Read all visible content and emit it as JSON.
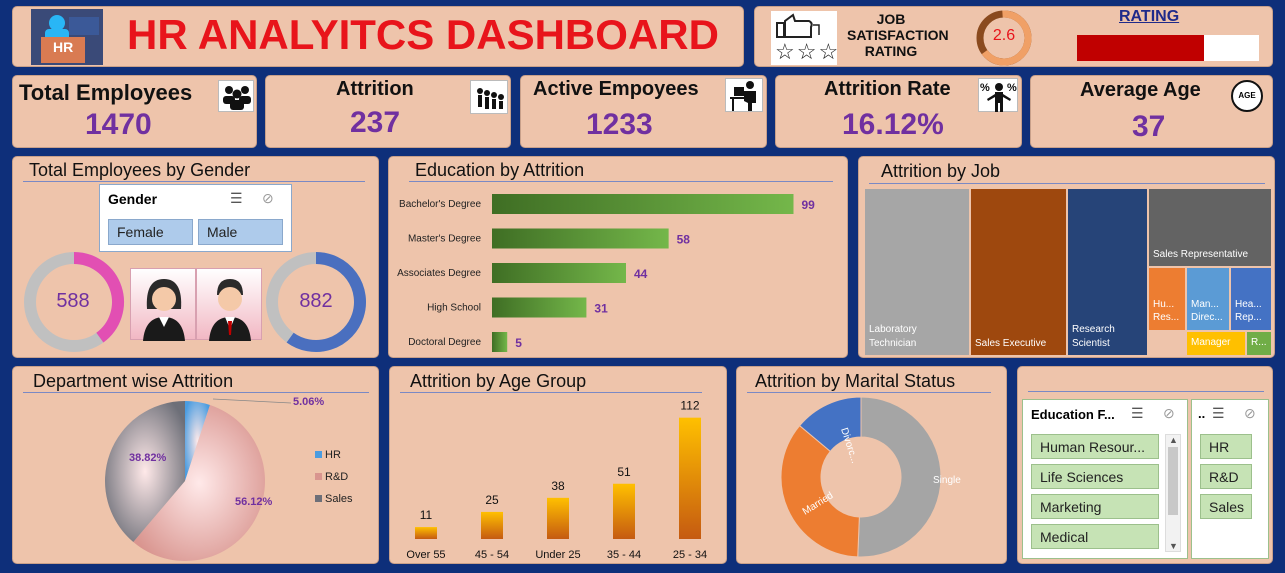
{
  "header": {
    "title": "HR ANALYITCS DASHBOARD",
    "logo_text": "HR"
  },
  "satisfaction": {
    "label": "JOB SATISFACTION RATING",
    "value": "2.6",
    "rating_label": "RATING",
    "rating_fraction": 0.7,
    "stars": "☆☆☆"
  },
  "kpis": [
    {
      "title": "Total Employees",
      "value": "1470",
      "icon": "people-group-icon"
    },
    {
      "title": "Attrition",
      "value": "237",
      "icon": "people-leaving-icon"
    },
    {
      "title": "Active Empoyees",
      "value": "1233",
      "icon": "desk-worker-icon"
    },
    {
      "title": "Attrition Rate",
      "value": "16.12%",
      "icon": "percent-person-icon"
    },
    {
      "title": "Average Age",
      "value": "37",
      "icon": "age-icon",
      "icon_text": "AGE"
    }
  ],
  "gender": {
    "title": "Total Employees by Gender",
    "slicer_title": "Gender",
    "options": [
      "Female",
      "Male"
    ],
    "female_value": "588",
    "male_value": "882",
    "colors": {
      "female": "#e24fb3",
      "male": "#4a6fbf",
      "ring": "#c0c0c0"
    }
  },
  "education": {
    "title": "Education by Attrition",
    "chart_data": {
      "type": "bar",
      "categories": [
        "Bachelor's Degree",
        "Master's Degree",
        "Associates Degree",
        "High School",
        "Doctoral Degree"
      ],
      "values": [
        99,
        58,
        44,
        31,
        5
      ],
      "xlim": [
        0,
        110
      ]
    }
  },
  "job": {
    "title": "Attrition by Job",
    "cells": [
      {
        "label": "Laboratory Technician",
        "color": "#a6a6a6"
      },
      {
        "label": "Sales Executive",
        "color": "#9e480e"
      },
      {
        "label": "Research Scientist",
        "color": "#264478"
      },
      {
        "label": "Sales Representative",
        "color": "#636363"
      },
      {
        "label": "Hu... Res...",
        "color": "#ed7d31"
      },
      {
        "label": "Man... Direc...",
        "color": "#5b9bd5"
      },
      {
        "label": "Hea... Rep...",
        "color": "#4472c4"
      },
      {
        "label": "Manager",
        "color": "#ffc000"
      },
      {
        "label": "R...",
        "color": "#70ad47"
      }
    ]
  },
  "department": {
    "title": "Department wise Attrition",
    "chart_data": {
      "type": "pie",
      "categories": [
        "HR",
        "R&D",
        "Sales"
      ],
      "values": [
        5.06,
        56.12,
        38.82
      ],
      "labels": [
        "5.06%",
        "56.12%",
        "38.82%"
      ],
      "colors": [
        "#4a9ce0",
        "#d9958f",
        "#6d6f78"
      ]
    }
  },
  "age": {
    "title": "Attrition by Age Group",
    "chart_data": {
      "type": "bar",
      "categories": [
        "Over 55",
        "45 - 54",
        "Under 25",
        "35 - 44",
        "25 - 34"
      ],
      "values": [
        11,
        25,
        38,
        51,
        112
      ],
      "ylim": [
        0,
        120
      ]
    }
  },
  "marital": {
    "title": "Attrition by Marital Status",
    "chart_data": {
      "type": "pie",
      "categories": [
        "Single",
        "Married",
        "Divorced"
      ],
      "values": [
        50.6,
        35.4,
        13.9
      ],
      "labels": [
        "Single",
        "Married",
        "Divorc..."
      ],
      "colors": [
        "#a5a5a5",
        "#ed7d31",
        "#4472c4"
      ]
    }
  },
  "filters": {
    "education_field": {
      "title": "Education F...",
      "options": [
        "Human Resour...",
        "Life Sciences",
        "Marketing",
        "Medical"
      ]
    },
    "department": {
      "title": "..",
      "options": [
        "HR",
        "R&D",
        "Sales"
      ]
    }
  }
}
